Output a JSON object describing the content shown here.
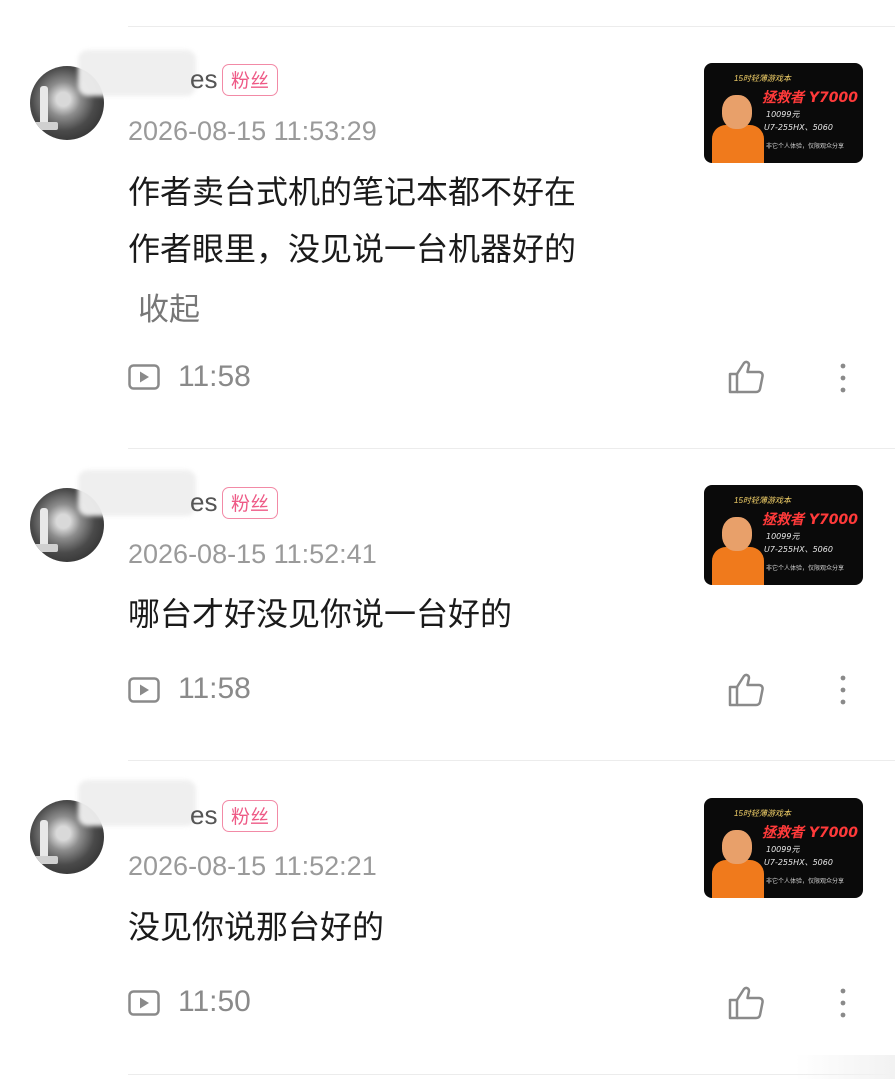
{
  "comments": [
    {
      "name_suffix": "es",
      "badge": "粉丝",
      "timestamp": "2026-08-15 11:53:29",
      "text_lines": [
        "作者卖台式机的笔记本都不好在",
        "作者眼里，没见说一台机器好的"
      ],
      "collapse_label": "收起",
      "video_time": "11:58"
    },
    {
      "name_suffix": "es",
      "badge": "粉丝",
      "timestamp": "2026-08-15 11:52:41",
      "text_lines": [
        "哪台才好没见你说一台好的"
      ],
      "video_time": "11:58"
    },
    {
      "name_suffix": "es",
      "badge": "粉丝",
      "timestamp": "2026-08-15 11:52:21",
      "text_lines": [
        "没见你说那台好的"
      ],
      "video_time": "11:50"
    }
  ],
  "thumbnail": {
    "line1": "15时轻薄游戏本",
    "line2": "拯救者 Y7000",
    "line3": "10099元",
    "line4": "U7-255HX、5060",
    "line5": "非它个人体验，仅限观众分享"
  },
  "icons": {
    "play": "play-icon",
    "like": "thumbs-up-icon",
    "more": "more-vertical-icon"
  },
  "colors": {
    "badge": "#ee5a86",
    "timestamp": "#9a9a9a",
    "text": "#1a1a1a"
  }
}
